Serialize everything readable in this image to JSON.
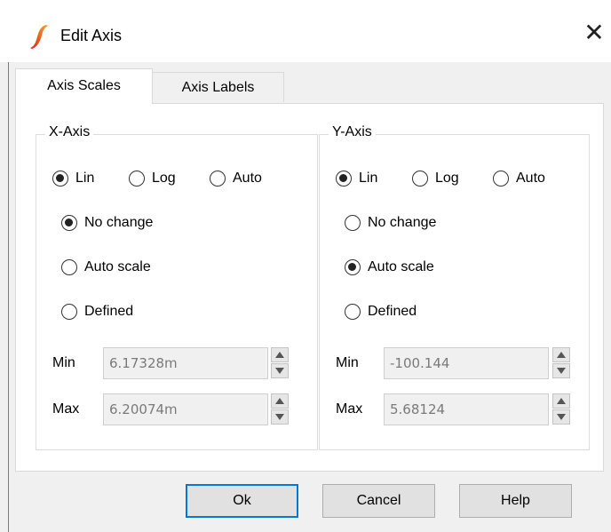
{
  "window": {
    "title": "Edit Axis",
    "close_glyph": "✕"
  },
  "tabs": [
    {
      "label": "Axis Scales",
      "active": true
    },
    {
      "label": "Axis Labels",
      "active": false
    }
  ],
  "x_axis": {
    "title": "X-Axis",
    "scale_type": {
      "lin": "Lin",
      "log": "Log",
      "auto": "Auto",
      "selected": "lin"
    },
    "mode": {
      "no_change": "No change",
      "auto_scale": "Auto scale",
      "defined": "Defined",
      "selected": "no_change"
    },
    "min_label": "Min",
    "min_value": "6.17328m",
    "max_label": "Max",
    "max_value": "6.20074m"
  },
  "y_axis": {
    "title": "Y-Axis",
    "scale_type": {
      "lin": "Lin",
      "log": "Log",
      "auto": "Auto",
      "selected": "lin"
    },
    "mode": {
      "no_change": "No change",
      "auto_scale": "Auto scale",
      "defined": "Defined",
      "selected": "auto_scale"
    },
    "min_label": "Min",
    "min_value": "-100.144",
    "max_label": "Max",
    "max_value": "5.68124"
  },
  "buttons": {
    "ok": "Ok",
    "cancel": "Cancel",
    "help": "Help"
  },
  "colors": {
    "default_button_border": "#0078d7",
    "icon_red": "#e02020",
    "icon_orange": "#f5a623"
  },
  "icons": {
    "app": "simetrix-swoosh-icon",
    "close": "close-icon"
  }
}
